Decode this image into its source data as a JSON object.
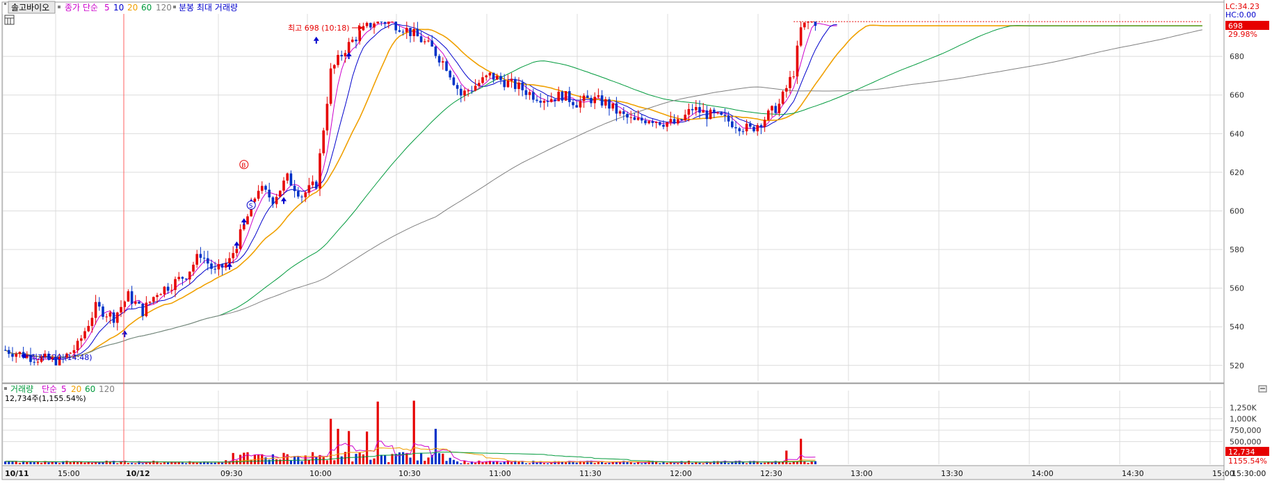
{
  "price_panel": {
    "stock_name": "솔고바이오",
    "legend_prefix": "종가 단순",
    "ma_periods": [
      "5",
      "10",
      "20",
      "60",
      "120"
    ],
    "legend_suffix": "분봉 최대 거래량",
    "lc_label": "LC:34.23",
    "hc_label": "HC:0.00",
    "current_price": "698",
    "change_pct": "29.98%",
    "high_annotation": "최고 698 (10:18)",
    "low_annotation": "최저 520 (14:48)",
    "buy_label": "B",
    "sell_label": "S"
  },
  "volume_panel": {
    "legend_title": "거래량",
    "legend_prefix": "단순",
    "ma_periods": [
      "5",
      "20",
      "60",
      "120"
    ],
    "volume_text": "12,734주(1,155.54%)",
    "current_volume": "12,734",
    "current_volume_pct": "1155.54%",
    "axis_ticks": [
      "1,250K",
      "1,000K",
      "750,000",
      "500,000"
    ]
  },
  "colors": {
    "up": "#e60000",
    "down": "#0032c8",
    "ma5": "#cc00cc",
    "ma10": "#0000cc",
    "ma20": "#f0a000",
    "ma60": "#009a3c",
    "ma120": "#808080",
    "grid": "#dcdcdc"
  },
  "chart_data": {
    "type": "candlestick",
    "title": "솔고바이오 분봉",
    "y_axis": {
      "range": [
        512,
        702
      ],
      "ticks": [
        520,
        540,
        560,
        580,
        600,
        620,
        640,
        660,
        680
      ]
    },
    "x_axis": {
      "labels": [
        "10/11",
        "15:00",
        "10/12",
        "09:30",
        "10:00",
        "10:30",
        "11:00",
        "11:30",
        "12:00",
        "12:30",
        "13:00",
        "13:30",
        "14:00",
        "14:30",
        "15:00",
        "15:30:00"
      ]
    },
    "high": {
      "value": 698,
      "time": "10:18"
    },
    "low": {
      "value": 520,
      "time": "14:48"
    },
    "last_close": 698,
    "price_path": [
      [
        0,
        528
      ],
      [
        8,
        524
      ],
      [
        15,
        522
      ],
      [
        20,
        530
      ],
      [
        25,
        550
      ],
      [
        30,
        545
      ],
      [
        34,
        556
      ],
      [
        38,
        548
      ],
      [
        42,
        558
      ],
      [
        46,
        562
      ],
      [
        50,
        567
      ],
      [
        54,
        578
      ],
      [
        58,
        568
      ],
      [
        62,
        574
      ],
      [
        66,
        592
      ],
      [
        70,
        612
      ],
      [
        74,
        606
      ],
      [
        78,
        617
      ],
      [
        82,
        608
      ],
      [
        86,
        614
      ],
      [
        90,
        672
      ],
      [
        94,
        684
      ],
      [
        98,
        692
      ],
      [
        102,
        698
      ],
      [
        106,
        698
      ],
      [
        110,
        695
      ],
      [
        114,
        690
      ],
      [
        118,
        684
      ],
      [
        122,
        675
      ],
      [
        126,
        660
      ],
      [
        130,
        665
      ],
      [
        134,
        670
      ],
      [
        138,
        667
      ],
      [
        142,
        664
      ],
      [
        146,
        660
      ],
      [
        150,
        658
      ],
      [
        154,
        660
      ],
      [
        158,
        656
      ],
      [
        162,
        658
      ],
      [
        166,
        656
      ],
      [
        170,
        650
      ],
      [
        174,
        646
      ],
      [
        178,
        648
      ],
      [
        182,
        646
      ],
      [
        186,
        645
      ],
      [
        190,
        653
      ],
      [
        194,
        650
      ],
      [
        198,
        648
      ],
      [
        202,
        645
      ],
      [
        206,
        642
      ],
      [
        210,
        648
      ],
      [
        214,
        655
      ],
      [
        218,
        672
      ],
      [
        220,
        694
      ],
      [
        222,
        698
      ]
    ],
    "volume_spikes": [
      {
        "bar": 78,
        "volume": 220000
      },
      {
        "bar": 80,
        "volume": 180000
      },
      {
        "bar": 90,
        "volume": 1000000
      },
      {
        "bar": 92,
        "volume": 780000
      },
      {
        "bar": 95,
        "volume": 730000
      },
      {
        "bar": 100,
        "volume": 720000
      },
      {
        "bar": 103,
        "volume": 1380000
      },
      {
        "bar": 113,
        "volume": 1400000
      },
      {
        "bar": 119,
        "volume": 780000
      },
      {
        "bar": 216,
        "volume": 300000
      },
      {
        "bar": 220,
        "volume": 560000
      }
    ]
  }
}
